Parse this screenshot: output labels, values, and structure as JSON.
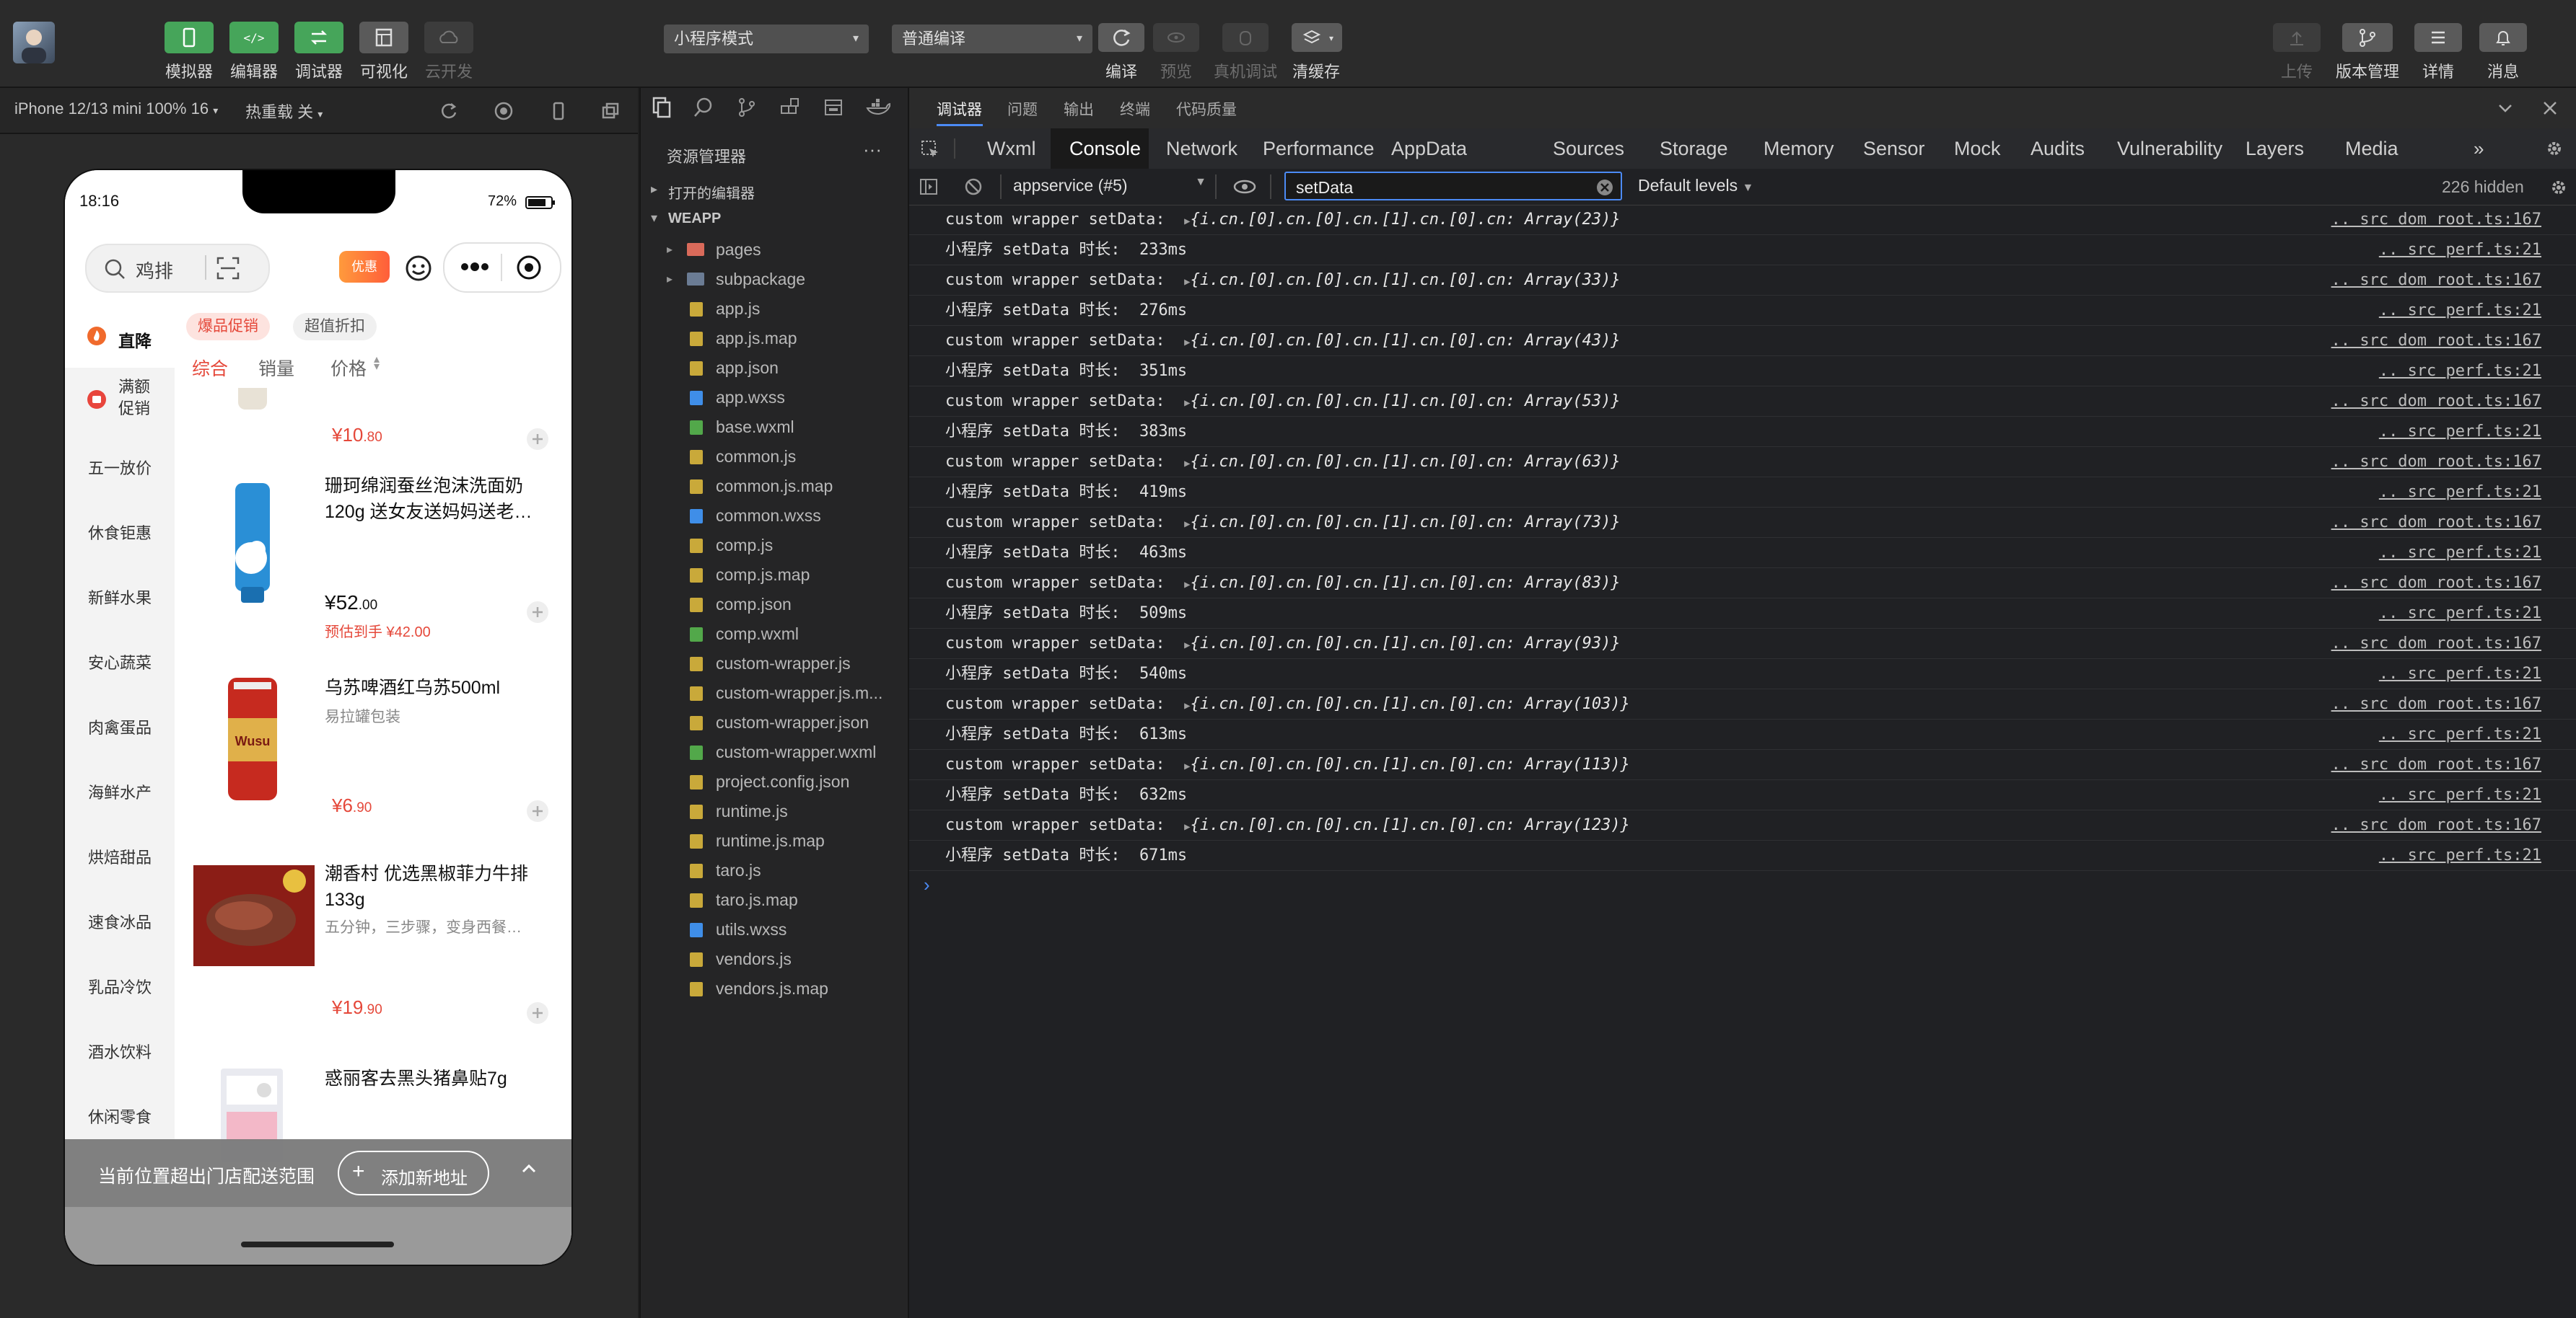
{
  "toolbar": {
    "left_buttons": [
      {
        "label": "模拟器",
        "icon": "phone-icon"
      },
      {
        "label": "编辑器",
        "icon": "code-icon"
      },
      {
        "label": "调试器",
        "icon": "debug-icon"
      },
      {
        "label": "可视化",
        "icon": "layout-icon"
      },
      {
        "label": "云开发",
        "icon": "cloud-icon"
      }
    ],
    "mode_select": "小程序模式",
    "compile_select": "普通编译",
    "mid_buttons": [
      {
        "label": "编译",
        "icon": "refresh-icon"
      },
      {
        "label": "预览",
        "icon": "eye-icon"
      },
      {
        "label": "真机调试",
        "icon": "bug-icon"
      },
      {
        "label": "清缓存",
        "icon": "layers-icon"
      }
    ],
    "right_buttons": [
      {
        "label": "上传",
        "icon": "upload-icon"
      },
      {
        "label": "版本管理",
        "icon": "branch-icon"
      },
      {
        "label": "详情",
        "icon": "menu-icon"
      },
      {
        "label": "消息",
        "icon": "bell-icon"
      }
    ]
  },
  "simulator": {
    "device": "iPhone 12/13 mini 100% 16",
    "hot_reload": "热重载 关",
    "phone": {
      "time": "18:16",
      "battery": "72%",
      "search_placeholder": "鸡排",
      "promo_badge": "优惠",
      "left_nav": [
        "直降",
        "满额促销",
        "五一放价",
        "休食钜惠",
        "新鲜水果",
        "安心蔬菜",
        "肉禽蛋品",
        "海鲜水产",
        "烘焙甜品",
        "速食冰品",
        "乳品冷饮",
        "酒水饮料",
        "休闲零食"
      ],
      "chips": [
        "爆品促销",
        "超值折扣"
      ],
      "sort_tabs": [
        "综合",
        "销量",
        "价格"
      ],
      "products": [
        {
          "name": "",
          "desc": "",
          "price_int": "¥10",
          "price_dec": ".80",
          "extra": ""
        },
        {
          "name": "珊珂绵润蚕丝泡沫洗面奶120g 送女友送妈妈送老…",
          "desc": "",
          "price_int": "¥52",
          "price_dec": ".00",
          "extra": "预估到手 ¥42.00"
        },
        {
          "name": "乌苏啤酒红乌苏500ml",
          "desc": "易拉罐包装",
          "price_int": "¥6",
          "price_dec": ".90",
          "extra": ""
        },
        {
          "name": "潮香村 优选黑椒菲力牛排133g",
          "desc": "五分钟，三步骤，变身西餐…",
          "price_int": "¥19",
          "price_dec": ".90",
          "extra": ""
        },
        {
          "name": "惑丽客去黑头猪鼻贴7g",
          "desc": "",
          "price_int": "",
          "price_dec": "",
          "extra": ""
        }
      ],
      "bottom_banner": "当前位置超出门店配送范围",
      "add_address": "添加新地址"
    }
  },
  "explorer": {
    "title": "资源管理器",
    "open_editors": "打开的编辑器",
    "project": "WEAPP",
    "files": [
      {
        "name": "pages",
        "type": "folder-special"
      },
      {
        "name": "subpackage",
        "type": "folder"
      },
      {
        "name": "app.js",
        "type": "js"
      },
      {
        "name": "app.js.map",
        "type": "js"
      },
      {
        "name": "app.json",
        "type": "json"
      },
      {
        "name": "app.wxss",
        "type": "css"
      },
      {
        "name": "base.wxml",
        "type": "wxml"
      },
      {
        "name": "common.js",
        "type": "js"
      },
      {
        "name": "common.js.map",
        "type": "js"
      },
      {
        "name": "common.wxss",
        "type": "css"
      },
      {
        "name": "comp.js",
        "type": "js"
      },
      {
        "name": "comp.js.map",
        "type": "js"
      },
      {
        "name": "comp.json",
        "type": "json"
      },
      {
        "name": "comp.wxml",
        "type": "wxml"
      },
      {
        "name": "custom-wrapper.js",
        "type": "js"
      },
      {
        "name": "custom-wrapper.js.m...",
        "type": "js"
      },
      {
        "name": "custom-wrapper.json",
        "type": "json"
      },
      {
        "name": "custom-wrapper.wxml",
        "type": "wxml"
      },
      {
        "name": "project.config.json",
        "type": "json"
      },
      {
        "name": "runtime.js",
        "type": "js"
      },
      {
        "name": "runtime.js.map",
        "type": "js"
      },
      {
        "name": "taro.js",
        "type": "js"
      },
      {
        "name": "taro.js.map",
        "type": "js"
      },
      {
        "name": "utils.wxss",
        "type": "css"
      },
      {
        "name": "vendors.js",
        "type": "js"
      },
      {
        "name": "vendors.js.map",
        "type": "js"
      }
    ]
  },
  "devtools": {
    "top_tabs": [
      "调试器",
      "问题",
      "输出",
      "终端",
      "代码质量"
    ],
    "panel_tabs": [
      "Wxml",
      "Console",
      "Network",
      "Performance",
      "AppData",
      "Sources",
      "Storage",
      "Memory",
      "Sensor",
      "Mock",
      "Audits",
      "Vulnerability",
      "Layers",
      "Media"
    ],
    "active_panel": "Console",
    "context": "appservice (#5)",
    "filter": "setData",
    "levels": "Default levels",
    "hidden": "226 hidden",
    "logs": [
      {
        "msg": "custom wrapper setData:  ",
        "obj": "{i.cn.[0].cn.[0].cn.[1].cn.[0].cn: Array(23)}",
        "src": ".. src dom root.ts:167"
      },
      {
        "msg": "小程序 setData 时长:  233ms",
        "obj": "",
        "src": ".. src perf.ts:21"
      },
      {
        "msg": "custom wrapper setData:  ",
        "obj": "{i.cn.[0].cn.[0].cn.[1].cn.[0].cn: Array(33)}",
        "src": ".. src dom root.ts:167"
      },
      {
        "msg": "小程序 setData 时长:  276ms",
        "obj": "",
        "src": ".. src perf.ts:21"
      },
      {
        "msg": "custom wrapper setData:  ",
        "obj": "{i.cn.[0].cn.[0].cn.[1].cn.[0].cn: Array(43)}",
        "src": ".. src dom root.ts:167"
      },
      {
        "msg": "小程序 setData 时长:  351ms",
        "obj": "",
        "src": ".. src perf.ts:21"
      },
      {
        "msg": "custom wrapper setData:  ",
        "obj": "{i.cn.[0].cn.[0].cn.[1].cn.[0].cn: Array(53)}",
        "src": ".. src dom root.ts:167"
      },
      {
        "msg": "小程序 setData 时长:  383ms",
        "obj": "",
        "src": ".. src perf.ts:21"
      },
      {
        "msg": "custom wrapper setData:  ",
        "obj": "{i.cn.[0].cn.[0].cn.[1].cn.[0].cn: Array(63)}",
        "src": ".. src dom root.ts:167"
      },
      {
        "msg": "小程序 setData 时长:  419ms",
        "obj": "",
        "src": ".. src perf.ts:21"
      },
      {
        "msg": "custom wrapper setData:  ",
        "obj": "{i.cn.[0].cn.[0].cn.[1].cn.[0].cn: Array(73)}",
        "src": ".. src dom root.ts:167"
      },
      {
        "msg": "小程序 setData 时长:  463ms",
        "obj": "",
        "src": ".. src perf.ts:21"
      },
      {
        "msg": "custom wrapper setData:  ",
        "obj": "{i.cn.[0].cn.[0].cn.[1].cn.[0].cn: Array(83)}",
        "src": ".. src dom root.ts:167"
      },
      {
        "msg": "小程序 setData 时长:  509ms",
        "obj": "",
        "src": ".. src perf.ts:21"
      },
      {
        "msg": "custom wrapper setData:  ",
        "obj": "{i.cn.[0].cn.[0].cn.[1].cn.[0].cn: Array(93)}",
        "src": ".. src dom root.ts:167"
      },
      {
        "msg": "小程序 setData 时长:  540ms",
        "obj": "",
        "src": ".. src perf.ts:21"
      },
      {
        "msg": "custom wrapper setData:  ",
        "obj": "{i.cn.[0].cn.[0].cn.[1].cn.[0].cn: Array(103)}",
        "src": ".. src dom root.ts:167"
      },
      {
        "msg": "小程序 setData 时长:  613ms",
        "obj": "",
        "src": ".. src perf.ts:21"
      },
      {
        "msg": "custom wrapper setData:  ",
        "obj": "{i.cn.[0].cn.[0].cn.[1].cn.[0].cn: Array(113)}",
        "src": ".. src dom root.ts:167"
      },
      {
        "msg": "小程序 setData 时长:  632ms",
        "obj": "",
        "src": ".. src perf.ts:21"
      },
      {
        "msg": "custom wrapper setData:  ",
        "obj": "{i.cn.[0].cn.[0].cn.[1].cn.[0].cn: Array(123)}",
        "src": ".. src dom root.ts:167"
      },
      {
        "msg": "小程序 setData 时长:  671ms",
        "obj": "",
        "src": ".. src perf.ts:21"
      }
    ]
  }
}
